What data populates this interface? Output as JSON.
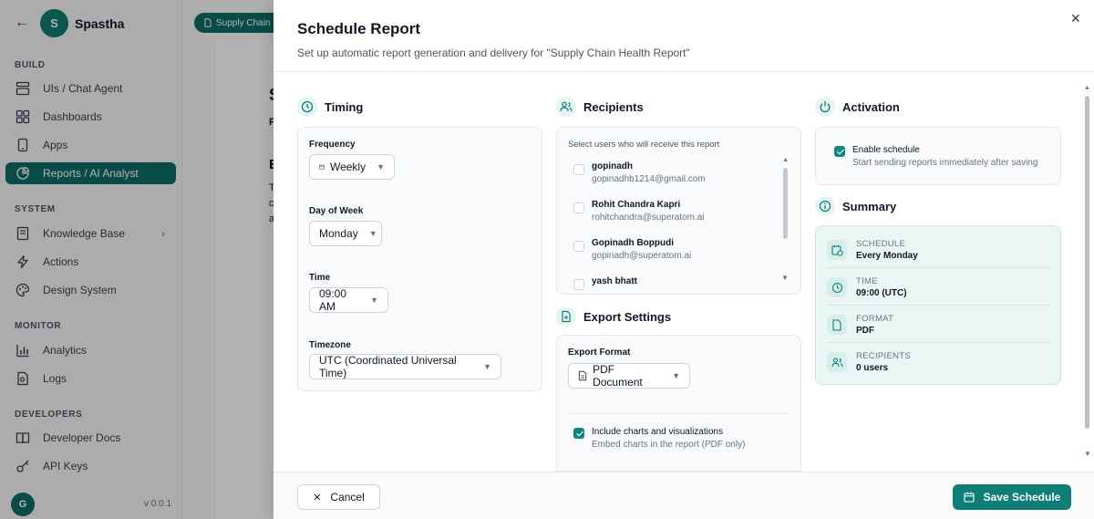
{
  "sidebar": {
    "brand_initial": "S",
    "brand_name": "Spastha",
    "sections": {
      "build": "BUILD",
      "system": "SYSTEM",
      "monitor": "MONITOR",
      "developers": "DEVELOPERS"
    },
    "items": {
      "uis": "UIs / Chat Agent",
      "dashboards": "Dashboards",
      "apps": "Apps",
      "reports": "Reports / AI Analyst",
      "knowledge": "Knowledge Base",
      "actions": "Actions",
      "design": "Design System",
      "analytics": "Analytics",
      "logs": "Logs",
      "docs": "Developer Docs",
      "apikeys": "API Keys"
    },
    "footer_initial": "G",
    "version": "v 0.0.1"
  },
  "background": {
    "tab_label": "Supply Chain H",
    "letters": [
      "S",
      "P",
      "E",
      "T",
      "c",
      "a"
    ]
  },
  "modal": {
    "title": "Schedule Report",
    "subtitle": "Set up automatic report generation and delivery for \"Supply Chain Health Report\"",
    "timing": {
      "heading": "Timing",
      "frequency_label": "Frequency",
      "frequency_value": "Weekly",
      "day_label": "Day of Week",
      "day_value": "Monday",
      "time_label": "Time",
      "time_value": "09:00 AM",
      "timezone_label": "Timezone",
      "timezone_value": "UTC (Coordinated Universal Time)"
    },
    "recipients": {
      "heading": "Recipients",
      "hint": "Select users who will receive this report",
      "users": [
        {
          "name": "gopinadh",
          "email": "gopinadhb1214@gmail.com"
        },
        {
          "name": "Rohit Chandra Kapri",
          "email": "rohitchandra@superatom.ai"
        },
        {
          "name": "Gopinadh Boppudi",
          "email": "gopinadh@superatom.ai"
        },
        {
          "name": "yash bhatt",
          "email": ""
        }
      ]
    },
    "export": {
      "heading": "Export Settings",
      "format_label": "Export Format",
      "format_value": "PDF Document",
      "charts_label": "Include charts and visualizations",
      "charts_desc": "Embed charts in the report (PDF only)"
    },
    "activation": {
      "heading": "Activation",
      "enable_label": "Enable schedule",
      "enable_desc": "Start sending reports immediately after saving"
    },
    "summary": {
      "heading": "Summary",
      "schedule_label": "SCHEDULE",
      "schedule_value": "Every Monday",
      "time_label": "TIME",
      "time_value": "09:00 (UTC)",
      "format_label": "FORMAT",
      "format_value": "PDF",
      "recipients_label": "RECIPIENTS",
      "recipients_value": "0 users"
    },
    "footer": {
      "cancel": "Cancel",
      "save": "Save Schedule"
    }
  },
  "colors": {
    "accent": "#0d7f76",
    "accent_light": "#e6f4f2",
    "summary_bg": "#eaf6f3"
  }
}
